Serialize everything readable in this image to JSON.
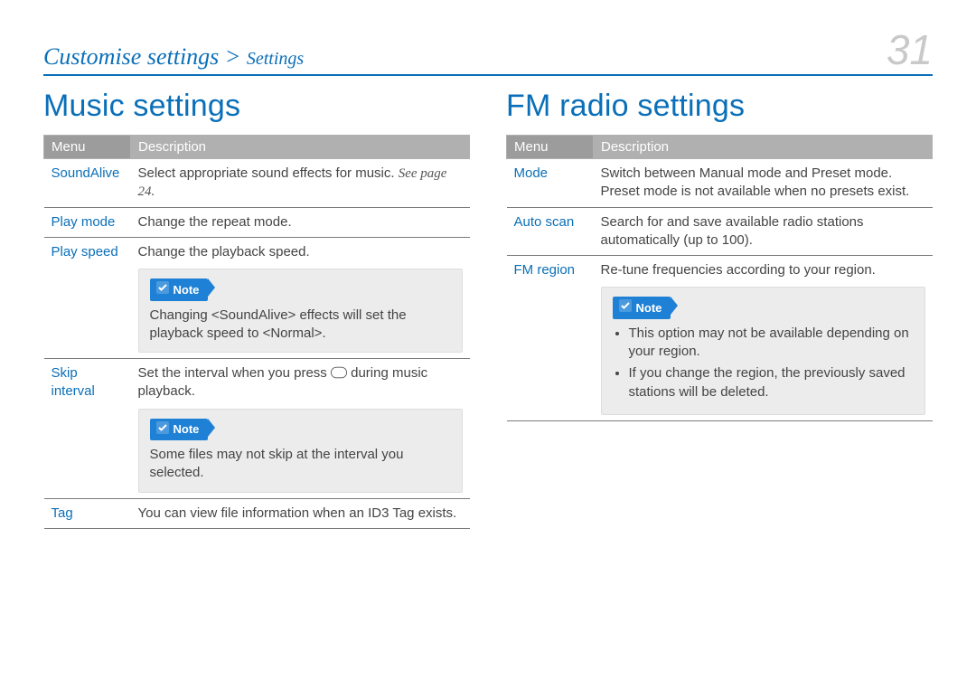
{
  "breadcrumb": {
    "main": "Customise settings",
    "sep": ">",
    "sub": "Settings"
  },
  "page_number": "31",
  "left": {
    "heading": "Music settings",
    "headers": {
      "menu": "Menu",
      "desc": "Description"
    },
    "rows": {
      "soundalive": {
        "menu": "SoundAlive",
        "desc_before": "Select appropriate sound effects for music. ",
        "see_page": "See page 24."
      },
      "playmode": {
        "menu": "Play mode",
        "desc": "Change the repeat mode."
      },
      "playspeed": {
        "menu": "Play speed",
        "desc_top": "Change the playback speed.",
        "note_label": "Note",
        "note_text": "Changing <SoundAlive> effects will set the playback speed to <Normal>."
      },
      "skip": {
        "menu": "Skip interval",
        "desc_top_before": "Set the interval when you press ",
        "desc_top_after": " during music playback.",
        "note_label": "Note",
        "note_text": "Some files may not skip at the interval you selected."
      },
      "tag": {
        "menu": "Tag",
        "desc": "You can view file information when an ID3 Tag exists."
      }
    }
  },
  "right": {
    "heading": "FM radio settings",
    "headers": {
      "menu": "Menu",
      "desc": "Description"
    },
    "rows": {
      "mode": {
        "menu": "Mode",
        "desc": "Switch between Manual mode and Preset mode. Preset mode is not available when no presets exist."
      },
      "autoscan": {
        "menu": "Auto scan",
        "desc": "Search for and save available radio stations automatically (up to 100)."
      },
      "fmregion": {
        "menu": "FM region",
        "desc_top": "Re-tune frequencies according to your region.",
        "note_label": "Note",
        "bullets": [
          "This option may not be available depending on your region.",
          "If you change the region, the previously saved stations will be deleted."
        ]
      }
    }
  }
}
